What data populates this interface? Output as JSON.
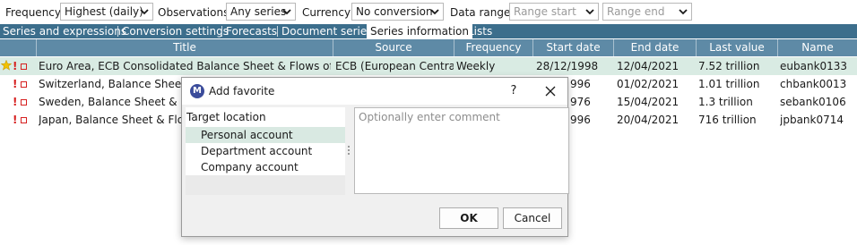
{
  "toolbar": {
    "frequency_label": "Frequency",
    "frequency_value": "Highest (daily)",
    "observations_label": "Observations",
    "observations_value": "Any series",
    "currency_label": "Currency",
    "currency_value": "No conversion",
    "data_range_label": "Data range",
    "range_start_placeholder": "Range start",
    "range_end_placeholder": "Range end"
  },
  "tabs": [
    {
      "label": "Series and expressions",
      "active": false
    },
    {
      "label": "Conversion settings",
      "active": false
    },
    {
      "label": "Forecasts",
      "active": false
    },
    {
      "label": "Document series",
      "active": false
    },
    {
      "label": "Series information",
      "active": true
    },
    {
      "label": "Lists",
      "active": false
    }
  ],
  "table": {
    "columns": [
      "Title",
      "Source",
      "Frequency",
      "Start date",
      "End date",
      "Last value",
      "Name"
    ],
    "rows": [
      {
        "favorite": true,
        "title": "Euro Area, ECB Consolidated Balance Sheet & Flows of MFI...",
        "source": "ECB (European Central...",
        "frequency": "Weekly",
        "start": "28/12/1998",
        "end": "12/04/2021",
        "last": "7.52 trillion",
        "name": "eubank0133",
        "selected": true
      },
      {
        "favorite": false,
        "title": "Switzerland, Balance Sheet & F",
        "source": "",
        "frequency": "",
        "start": "996",
        "end": "01/02/2021",
        "last": "1.01 trillion",
        "name": "chbank0013",
        "selected": false
      },
      {
        "favorite": false,
        "title": "Sweden, Balance Sheet & Flow",
        "source": "",
        "frequency": "",
        "start": "976",
        "end": "15/04/2021",
        "last": "1.3 trillion",
        "name": "sebank0106",
        "selected": false
      },
      {
        "favorite": false,
        "title": "Japan, Balance Sheet & Flows",
        "source": "",
        "frequency": "",
        "start": "996",
        "end": "20/04/2021",
        "last": "716 trillion",
        "name": "jpbank0714",
        "selected": false
      }
    ]
  },
  "dialog": {
    "title": "Add favorite",
    "logo_letter": "M",
    "help": "?",
    "target_location_label": "Target location",
    "locations": [
      "Personal account",
      "Department account",
      "Company account"
    ],
    "selected_location": "Personal account",
    "comment_placeholder": "Optionally enter comment",
    "ok_label": "OK",
    "cancel_label": "Cancel"
  },
  "colors": {
    "tab_bar": "#3c6e8c",
    "header": "#5e8aa6",
    "selected_row": "#d9ebe3",
    "flag_red": "#d62020",
    "star": "#f2c200"
  }
}
